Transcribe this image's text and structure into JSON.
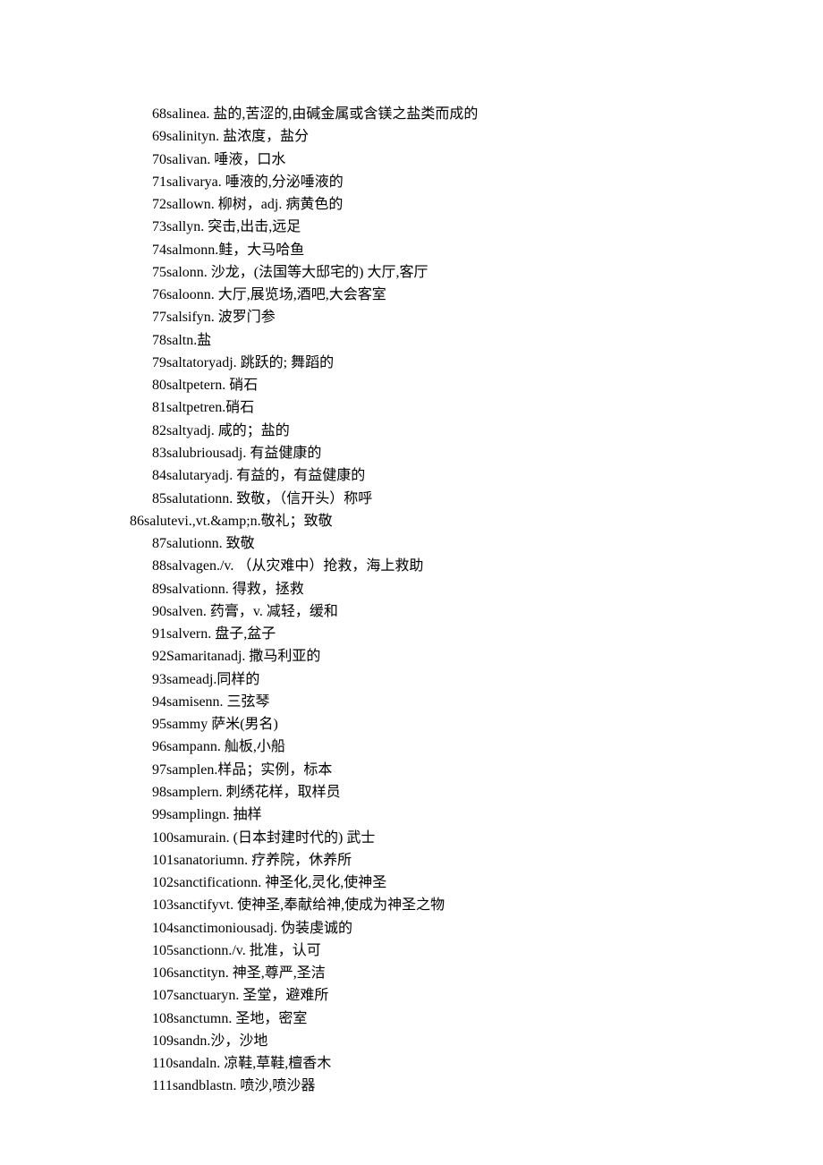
{
  "entries": [
    {
      "num": "68",
      "word": "saline",
      "def": "a. 盐的,苦涩的,由碱金属或含镁之盐类而成的"
    },
    {
      "num": "69",
      "word": "salinity",
      "def": "n. 盐浓度，盐分"
    },
    {
      "num": "70",
      "word": "saliva",
      "def": "n. 唾液，口水"
    },
    {
      "num": "71",
      "word": "salivary",
      "def": "a. 唾液的,分泌唾液的"
    },
    {
      "num": "72",
      "word": "sallow",
      "def": "n. 柳树，adj. 病黄色的"
    },
    {
      "num": "73",
      "word": "sally",
      "def": "n. 突击,出击,远足"
    },
    {
      "num": "74",
      "word": "salmon",
      "def": "n.鲑，大马哈鱼"
    },
    {
      "num": "75",
      "word": "salon",
      "def": "n. 沙龙，(法国等大邸宅的) 大厅,客厅"
    },
    {
      "num": "76",
      "word": "saloon",
      "def": "n. 大厅,展览场,酒吧,大会客室"
    },
    {
      "num": "77",
      "word": "salsify",
      "def": "n. 波罗门参"
    },
    {
      "num": "78",
      "word": "salt",
      "def": "n.盐"
    },
    {
      "num": "79",
      "word": "saltatory",
      "def": "adj. 跳跃的; 舞蹈的"
    },
    {
      "num": "80",
      "word": "saltpeter",
      "def": "n. 硝石"
    },
    {
      "num": "81",
      "word": "saltpetre",
      "def": "n.硝石"
    },
    {
      "num": "82",
      "word": "salty",
      "def": "adj. 咸的；盐的"
    },
    {
      "num": "83",
      "word": "salubrious",
      "def": "adj. 有益健康的"
    },
    {
      "num": "84",
      "word": "salutary",
      "def": "adj. 有益的，有益健康的"
    },
    {
      "num": "85",
      "word": "salutation",
      "def": "n. 致敬，（信开头）称呼"
    },
    {
      "num": "86",
      "word": "salute",
      "def": "vi.,vt.&amp;n.敬礼；致敬",
      "outdent": true
    },
    {
      "num": "87",
      "word": "salution",
      "def": "n. 致敬"
    },
    {
      "num": "88",
      "word": "salvage",
      "def": "n./v. （从灾难中）抢救，海上救助"
    },
    {
      "num": "89",
      "word": "salvation",
      "def": "n. 得救，拯救"
    },
    {
      "num": "90",
      "word": "salve",
      "def": "n. 药膏，v. 减轻，缓和"
    },
    {
      "num": "91",
      "word": "salver",
      "def": "n. 盘子,盆子"
    },
    {
      "num": "92",
      "word": "Samaritan",
      "def": "adj. 撒马利亚的"
    },
    {
      "num": "93",
      "word": "same",
      "def": "adj.同样的"
    },
    {
      "num": "94",
      "word": "samisen",
      "def": "n. 三弦琴"
    },
    {
      "num": "95",
      "word": "sammy",
      "def": "萨米(男名)",
      "space": true
    },
    {
      "num": "96",
      "word": "sampan",
      "def": "n. 舢板,小船"
    },
    {
      "num": "97",
      "word": "sample",
      "def": "n.样品；实例，标本"
    },
    {
      "num": "98",
      "word": "sampler",
      "def": "n. 刺绣花样，取样员"
    },
    {
      "num": "99",
      "word": "sampling",
      "def": "n. 抽样"
    },
    {
      "num": "100",
      "word": "samurai",
      "def": "n. (日本封建时代的) 武士"
    },
    {
      "num": "101",
      "word": "sanatorium",
      "def": "n. 疗养院，休养所"
    },
    {
      "num": "102",
      "word": "sanctification",
      "def": "n. 神圣化,灵化,使神圣"
    },
    {
      "num": "103",
      "word": "sanctify",
      "def": "vt. 使神圣,奉献给神,使成为神圣之物"
    },
    {
      "num": "104",
      "word": "sanctimonious",
      "def": "adj. 伪装虔诚的"
    },
    {
      "num": "105",
      "word": "sanction",
      "def": "n./v. 批准，认可"
    },
    {
      "num": "106",
      "word": "sanctity",
      "def": "n. 神圣,尊严,圣洁"
    },
    {
      "num": "107",
      "word": "sanctuary",
      "def": "n. 圣堂，避难所"
    },
    {
      "num": "108",
      "word": "sanctum",
      "def": "n. 圣地，密室"
    },
    {
      "num": "109",
      "word": "sand",
      "def": "n.沙，沙地"
    },
    {
      "num": "110",
      "word": "sandal",
      "def": "n. 凉鞋,草鞋,檀香木"
    },
    {
      "num": "111",
      "word": "sandblast",
      "def": "n. 喷沙,喷沙器"
    }
  ]
}
